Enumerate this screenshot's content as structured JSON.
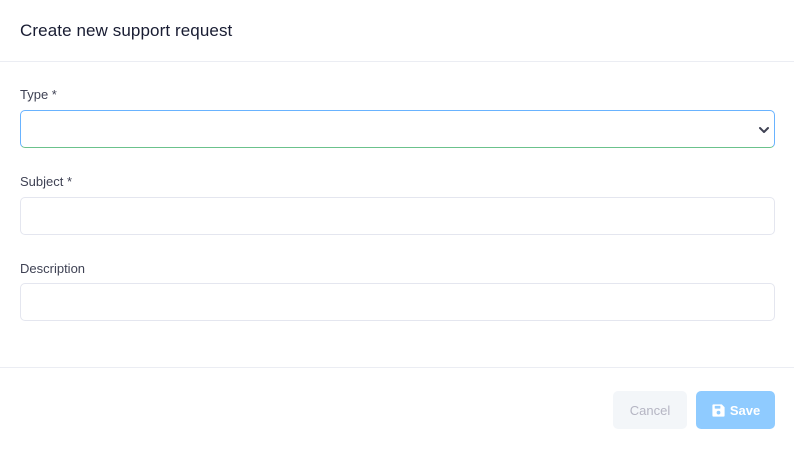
{
  "modal": {
    "title": "Create new support request"
  },
  "form": {
    "type": {
      "label": "Type *",
      "selected_value": ""
    },
    "subject": {
      "label": "Subject *",
      "value": ""
    },
    "description": {
      "label": "Description",
      "value": ""
    }
  },
  "footer": {
    "cancel_label": "Cancel",
    "save_label": "Save"
  },
  "icons": {
    "save": "floppy-disk-icon",
    "select": "chevron-down-icon"
  },
  "colors": {
    "save_button": "#8fcbff",
    "cancel_button": "#f3f6f9",
    "focus_border": "#69b3ff"
  }
}
